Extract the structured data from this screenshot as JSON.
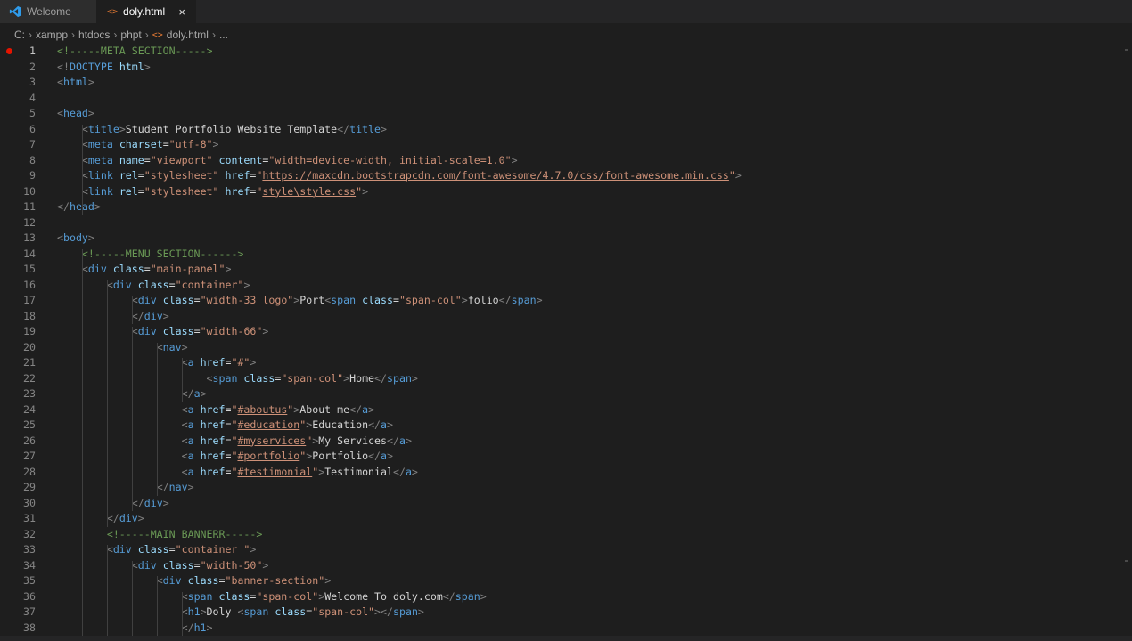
{
  "tabs": [
    {
      "label": "Welcome",
      "icon": "vscode-logo-icon",
      "active": false
    },
    {
      "label": "doly.html",
      "icon": "html-file-icon",
      "active": true,
      "close": "×"
    }
  ],
  "breadcrumb": [
    "C:",
    "xampp",
    "htdocs",
    "phpt",
    "doly.html",
    "..."
  ],
  "breakpoint_line": 1,
  "colors": {
    "tag": "#569cd6",
    "attr": "#9cdcfe",
    "value": "#ce9178",
    "comment": "#6a9955",
    "text": "#d4d4d4",
    "punct": "#808080",
    "breakpoint": "#e51400"
  },
  "lines": [
    [
      {
        "c": "cm",
        "t": "<!-----META SECTION----->"
      }
    ],
    [
      {
        "c": "t",
        "t": "<!"
      },
      {
        "c": "tn",
        "t": "DOCTYPE"
      },
      {
        "c": "tx",
        "t": " "
      },
      {
        "c": "an",
        "t": "html"
      },
      {
        "c": "t",
        "t": ">"
      }
    ],
    [
      {
        "c": "t",
        "t": "<"
      },
      {
        "c": "tn",
        "t": "html"
      },
      {
        "c": "t",
        "t": ">"
      }
    ],
    [],
    [
      {
        "c": "t",
        "t": "<"
      },
      {
        "c": "tn",
        "t": "head"
      },
      {
        "c": "t",
        "t": ">"
      }
    ],
    [
      {
        "c": "tx",
        "t": "    "
      },
      {
        "c": "t",
        "t": "<"
      },
      {
        "c": "tn",
        "t": "title"
      },
      {
        "c": "t",
        "t": ">"
      },
      {
        "c": "tx",
        "t": "Student Portfolio Website Template"
      },
      {
        "c": "t",
        "t": "</"
      },
      {
        "c": "tn",
        "t": "title"
      },
      {
        "c": "t",
        "t": ">"
      }
    ],
    [
      {
        "c": "tx",
        "t": "    "
      },
      {
        "c": "t",
        "t": "<"
      },
      {
        "c": "tn",
        "t": "meta"
      },
      {
        "c": "tx",
        "t": " "
      },
      {
        "c": "an",
        "t": "charset"
      },
      {
        "c": "tx",
        "t": "="
      },
      {
        "c": "av",
        "t": "\"utf-8\""
      },
      {
        "c": "t",
        "t": ">"
      }
    ],
    [
      {
        "c": "tx",
        "t": "    "
      },
      {
        "c": "t",
        "t": "<"
      },
      {
        "c": "tn",
        "t": "meta"
      },
      {
        "c": "tx",
        "t": " "
      },
      {
        "c": "an",
        "t": "name"
      },
      {
        "c": "tx",
        "t": "="
      },
      {
        "c": "av",
        "t": "\"viewport\""
      },
      {
        "c": "tx",
        "t": " "
      },
      {
        "c": "an",
        "t": "content"
      },
      {
        "c": "tx",
        "t": "="
      },
      {
        "c": "av",
        "t": "\"width=device-width, initial-scale=1.0\""
      },
      {
        "c": "t",
        "t": ">"
      }
    ],
    [
      {
        "c": "tx",
        "t": "    "
      },
      {
        "c": "t",
        "t": "<"
      },
      {
        "c": "tn",
        "t": "link"
      },
      {
        "c": "tx",
        "t": " "
      },
      {
        "c": "an",
        "t": "rel"
      },
      {
        "c": "tx",
        "t": "="
      },
      {
        "c": "av",
        "t": "\"stylesheet\""
      },
      {
        "c": "tx",
        "t": " "
      },
      {
        "c": "an",
        "t": "href"
      },
      {
        "c": "tx",
        "t": "="
      },
      {
        "c": "av",
        "t": "\""
      },
      {
        "c": "av ul",
        "t": "https://maxcdn.bootstrapcdn.com/font-awesome/4.7.0/css/font-awesome.min.css"
      },
      {
        "c": "av",
        "t": "\""
      },
      {
        "c": "t",
        "t": ">"
      }
    ],
    [
      {
        "c": "tx",
        "t": "    "
      },
      {
        "c": "t",
        "t": "<"
      },
      {
        "c": "tn",
        "t": "link"
      },
      {
        "c": "tx",
        "t": " "
      },
      {
        "c": "an",
        "t": "rel"
      },
      {
        "c": "tx",
        "t": "="
      },
      {
        "c": "av",
        "t": "\"stylesheet\""
      },
      {
        "c": "tx",
        "t": " "
      },
      {
        "c": "an",
        "t": "href"
      },
      {
        "c": "tx",
        "t": "="
      },
      {
        "c": "av",
        "t": "\""
      },
      {
        "c": "av ul",
        "t": "style\\style.css"
      },
      {
        "c": "av",
        "t": "\""
      },
      {
        "c": "t",
        "t": ">"
      }
    ],
    [
      {
        "c": "t",
        "t": "</"
      },
      {
        "c": "tn",
        "t": "head"
      },
      {
        "c": "t",
        "t": ">"
      }
    ],
    [],
    [
      {
        "c": "t",
        "t": "<"
      },
      {
        "c": "tn",
        "t": "body"
      },
      {
        "c": "t",
        "t": ">"
      }
    ],
    [
      {
        "c": "tx",
        "t": "    "
      },
      {
        "c": "cm",
        "t": "<!-----MENU SECTION------>"
      }
    ],
    [
      {
        "c": "tx",
        "t": "    "
      },
      {
        "c": "t",
        "t": "<"
      },
      {
        "c": "tn",
        "t": "div"
      },
      {
        "c": "tx",
        "t": " "
      },
      {
        "c": "an",
        "t": "class"
      },
      {
        "c": "tx",
        "t": "="
      },
      {
        "c": "av",
        "t": "\"main-panel\""
      },
      {
        "c": "t",
        "t": ">"
      }
    ],
    [
      {
        "c": "tx",
        "t": "        "
      },
      {
        "c": "t",
        "t": "<"
      },
      {
        "c": "tn",
        "t": "div"
      },
      {
        "c": "tx",
        "t": " "
      },
      {
        "c": "an",
        "t": "class"
      },
      {
        "c": "tx",
        "t": "="
      },
      {
        "c": "av",
        "t": "\"container\""
      },
      {
        "c": "t",
        "t": ">"
      }
    ],
    [
      {
        "c": "tx",
        "t": "            "
      },
      {
        "c": "t",
        "t": "<"
      },
      {
        "c": "tn",
        "t": "div"
      },
      {
        "c": "tx",
        "t": " "
      },
      {
        "c": "an",
        "t": "class"
      },
      {
        "c": "tx",
        "t": "="
      },
      {
        "c": "av",
        "t": "\"width-33 logo\""
      },
      {
        "c": "t",
        "t": ">"
      },
      {
        "c": "tx",
        "t": "Port"
      },
      {
        "c": "t",
        "t": "<"
      },
      {
        "c": "tn",
        "t": "span"
      },
      {
        "c": "tx",
        "t": " "
      },
      {
        "c": "an",
        "t": "class"
      },
      {
        "c": "tx",
        "t": "="
      },
      {
        "c": "av",
        "t": "\"span-col\""
      },
      {
        "c": "t",
        "t": ">"
      },
      {
        "c": "tx",
        "t": "folio"
      },
      {
        "c": "t",
        "t": "</"
      },
      {
        "c": "tn",
        "t": "span"
      },
      {
        "c": "t",
        "t": ">"
      }
    ],
    [
      {
        "c": "tx",
        "t": "            "
      },
      {
        "c": "t",
        "t": "</"
      },
      {
        "c": "tn",
        "t": "div"
      },
      {
        "c": "t",
        "t": ">"
      }
    ],
    [
      {
        "c": "tx",
        "t": "            "
      },
      {
        "c": "t",
        "t": "<"
      },
      {
        "c": "tn",
        "t": "div"
      },
      {
        "c": "tx",
        "t": " "
      },
      {
        "c": "an",
        "t": "class"
      },
      {
        "c": "tx",
        "t": "="
      },
      {
        "c": "av",
        "t": "\"width-66\""
      },
      {
        "c": "t",
        "t": ">"
      }
    ],
    [
      {
        "c": "tx",
        "t": "                "
      },
      {
        "c": "t",
        "t": "<"
      },
      {
        "c": "tn",
        "t": "nav"
      },
      {
        "c": "t",
        "t": ">"
      }
    ],
    [
      {
        "c": "tx",
        "t": "                    "
      },
      {
        "c": "t",
        "t": "<"
      },
      {
        "c": "tn",
        "t": "a"
      },
      {
        "c": "tx",
        "t": " "
      },
      {
        "c": "an",
        "t": "href"
      },
      {
        "c": "tx",
        "t": "="
      },
      {
        "c": "av",
        "t": "\"#\""
      },
      {
        "c": "t",
        "t": ">"
      }
    ],
    [
      {
        "c": "tx",
        "t": "                        "
      },
      {
        "c": "t",
        "t": "<"
      },
      {
        "c": "tn",
        "t": "span"
      },
      {
        "c": "tx",
        "t": " "
      },
      {
        "c": "an",
        "t": "class"
      },
      {
        "c": "tx",
        "t": "="
      },
      {
        "c": "av",
        "t": "\"span-col\""
      },
      {
        "c": "t",
        "t": ">"
      },
      {
        "c": "tx",
        "t": "Home"
      },
      {
        "c": "t",
        "t": "</"
      },
      {
        "c": "tn",
        "t": "span"
      },
      {
        "c": "t",
        "t": ">"
      }
    ],
    [
      {
        "c": "tx",
        "t": "                    "
      },
      {
        "c": "t",
        "t": "</"
      },
      {
        "c": "tn",
        "t": "a"
      },
      {
        "c": "t",
        "t": ">"
      }
    ],
    [
      {
        "c": "tx",
        "t": "                    "
      },
      {
        "c": "t",
        "t": "<"
      },
      {
        "c": "tn",
        "t": "a"
      },
      {
        "c": "tx",
        "t": " "
      },
      {
        "c": "an",
        "t": "href"
      },
      {
        "c": "tx",
        "t": "="
      },
      {
        "c": "av",
        "t": "\""
      },
      {
        "c": "av ul",
        "t": "#aboutus"
      },
      {
        "c": "av",
        "t": "\""
      },
      {
        "c": "t",
        "t": ">"
      },
      {
        "c": "tx",
        "t": "About me"
      },
      {
        "c": "t",
        "t": "</"
      },
      {
        "c": "tn",
        "t": "a"
      },
      {
        "c": "t",
        "t": ">"
      }
    ],
    [
      {
        "c": "tx",
        "t": "                    "
      },
      {
        "c": "t",
        "t": "<"
      },
      {
        "c": "tn",
        "t": "a"
      },
      {
        "c": "tx",
        "t": " "
      },
      {
        "c": "an",
        "t": "href"
      },
      {
        "c": "tx",
        "t": "="
      },
      {
        "c": "av",
        "t": "\""
      },
      {
        "c": "av ul",
        "t": "#education"
      },
      {
        "c": "av",
        "t": "\""
      },
      {
        "c": "t",
        "t": ">"
      },
      {
        "c": "tx",
        "t": "Education"
      },
      {
        "c": "t",
        "t": "</"
      },
      {
        "c": "tn",
        "t": "a"
      },
      {
        "c": "t",
        "t": ">"
      }
    ],
    [
      {
        "c": "tx",
        "t": "                    "
      },
      {
        "c": "t",
        "t": "<"
      },
      {
        "c": "tn",
        "t": "a"
      },
      {
        "c": "tx",
        "t": " "
      },
      {
        "c": "an",
        "t": "href"
      },
      {
        "c": "tx",
        "t": "="
      },
      {
        "c": "av",
        "t": "\""
      },
      {
        "c": "av ul",
        "t": "#myservices"
      },
      {
        "c": "av",
        "t": "\""
      },
      {
        "c": "t",
        "t": ">"
      },
      {
        "c": "tx",
        "t": "My Services"
      },
      {
        "c": "t",
        "t": "</"
      },
      {
        "c": "tn",
        "t": "a"
      },
      {
        "c": "t",
        "t": ">"
      }
    ],
    [
      {
        "c": "tx",
        "t": "                    "
      },
      {
        "c": "t",
        "t": "<"
      },
      {
        "c": "tn",
        "t": "a"
      },
      {
        "c": "tx",
        "t": " "
      },
      {
        "c": "an",
        "t": "href"
      },
      {
        "c": "tx",
        "t": "="
      },
      {
        "c": "av",
        "t": "\""
      },
      {
        "c": "av ul",
        "t": "#portfolio"
      },
      {
        "c": "av",
        "t": "\""
      },
      {
        "c": "t",
        "t": ">"
      },
      {
        "c": "tx",
        "t": "Portfolio"
      },
      {
        "c": "t",
        "t": "</"
      },
      {
        "c": "tn",
        "t": "a"
      },
      {
        "c": "t",
        "t": ">"
      }
    ],
    [
      {
        "c": "tx",
        "t": "                    "
      },
      {
        "c": "t",
        "t": "<"
      },
      {
        "c": "tn",
        "t": "a"
      },
      {
        "c": "tx",
        "t": " "
      },
      {
        "c": "an",
        "t": "href"
      },
      {
        "c": "tx",
        "t": "="
      },
      {
        "c": "av",
        "t": "\""
      },
      {
        "c": "av ul",
        "t": "#testimonial"
      },
      {
        "c": "av",
        "t": "\""
      },
      {
        "c": "t",
        "t": ">"
      },
      {
        "c": "tx",
        "t": "Testimonial"
      },
      {
        "c": "t",
        "t": "</"
      },
      {
        "c": "tn",
        "t": "a"
      },
      {
        "c": "t",
        "t": ">"
      }
    ],
    [
      {
        "c": "tx",
        "t": "                "
      },
      {
        "c": "t",
        "t": "</"
      },
      {
        "c": "tn",
        "t": "nav"
      },
      {
        "c": "t",
        "t": ">"
      }
    ],
    [
      {
        "c": "tx",
        "t": "            "
      },
      {
        "c": "t",
        "t": "</"
      },
      {
        "c": "tn",
        "t": "div"
      },
      {
        "c": "t",
        "t": ">"
      }
    ],
    [
      {
        "c": "tx",
        "t": "        "
      },
      {
        "c": "t",
        "t": "</"
      },
      {
        "c": "tn",
        "t": "div"
      },
      {
        "c": "t",
        "t": ">"
      }
    ],
    [
      {
        "c": "tx",
        "t": "        "
      },
      {
        "c": "cm",
        "t": "<!-----MAIN BANNERR----->"
      }
    ],
    [
      {
        "c": "tx",
        "t": "        "
      },
      {
        "c": "t",
        "t": "<"
      },
      {
        "c": "tn",
        "t": "div"
      },
      {
        "c": "tx",
        "t": " "
      },
      {
        "c": "an",
        "t": "class"
      },
      {
        "c": "tx",
        "t": "="
      },
      {
        "c": "av",
        "t": "\"container \""
      },
      {
        "c": "t",
        "t": ">"
      }
    ],
    [
      {
        "c": "tx",
        "t": "            "
      },
      {
        "c": "t",
        "t": "<"
      },
      {
        "c": "tn",
        "t": "div"
      },
      {
        "c": "tx",
        "t": " "
      },
      {
        "c": "an",
        "t": "class"
      },
      {
        "c": "tx",
        "t": "="
      },
      {
        "c": "av",
        "t": "\"width-50\""
      },
      {
        "c": "t",
        "t": ">"
      }
    ],
    [
      {
        "c": "tx",
        "t": "                "
      },
      {
        "c": "t",
        "t": "<"
      },
      {
        "c": "tn",
        "t": "div"
      },
      {
        "c": "tx",
        "t": " "
      },
      {
        "c": "an",
        "t": "class"
      },
      {
        "c": "tx",
        "t": "="
      },
      {
        "c": "av",
        "t": "\"banner-section\""
      },
      {
        "c": "t",
        "t": ">"
      }
    ],
    [
      {
        "c": "tx",
        "t": "                    "
      },
      {
        "c": "t",
        "t": "<"
      },
      {
        "c": "tn",
        "t": "span"
      },
      {
        "c": "tx",
        "t": " "
      },
      {
        "c": "an",
        "t": "class"
      },
      {
        "c": "tx",
        "t": "="
      },
      {
        "c": "av",
        "t": "\"span-col\""
      },
      {
        "c": "t",
        "t": ">"
      },
      {
        "c": "tx",
        "t": "Welcome To doly.com"
      },
      {
        "c": "t",
        "t": "</"
      },
      {
        "c": "tn",
        "t": "span"
      },
      {
        "c": "t",
        "t": ">"
      }
    ],
    [
      {
        "c": "tx",
        "t": "                    "
      },
      {
        "c": "t",
        "t": "<"
      },
      {
        "c": "tn",
        "t": "h1"
      },
      {
        "c": "t",
        "t": ">"
      },
      {
        "c": "tx",
        "t": "Doly "
      },
      {
        "c": "t",
        "t": "<"
      },
      {
        "c": "tn",
        "t": "span"
      },
      {
        "c": "tx",
        "t": " "
      },
      {
        "c": "an",
        "t": "class"
      },
      {
        "c": "tx",
        "t": "="
      },
      {
        "c": "av",
        "t": "\"span-col\""
      },
      {
        "c": "t",
        "t": ">"
      },
      {
        "c": "t",
        "t": "</"
      },
      {
        "c": "tn",
        "t": "span"
      },
      {
        "c": "t",
        "t": ">"
      }
    ],
    [
      {
        "c": "tx",
        "t": "                    "
      },
      {
        "c": "t",
        "t": "</"
      },
      {
        "c": "tn",
        "t": "h1"
      },
      {
        "c": "t",
        "t": ">"
      }
    ]
  ]
}
